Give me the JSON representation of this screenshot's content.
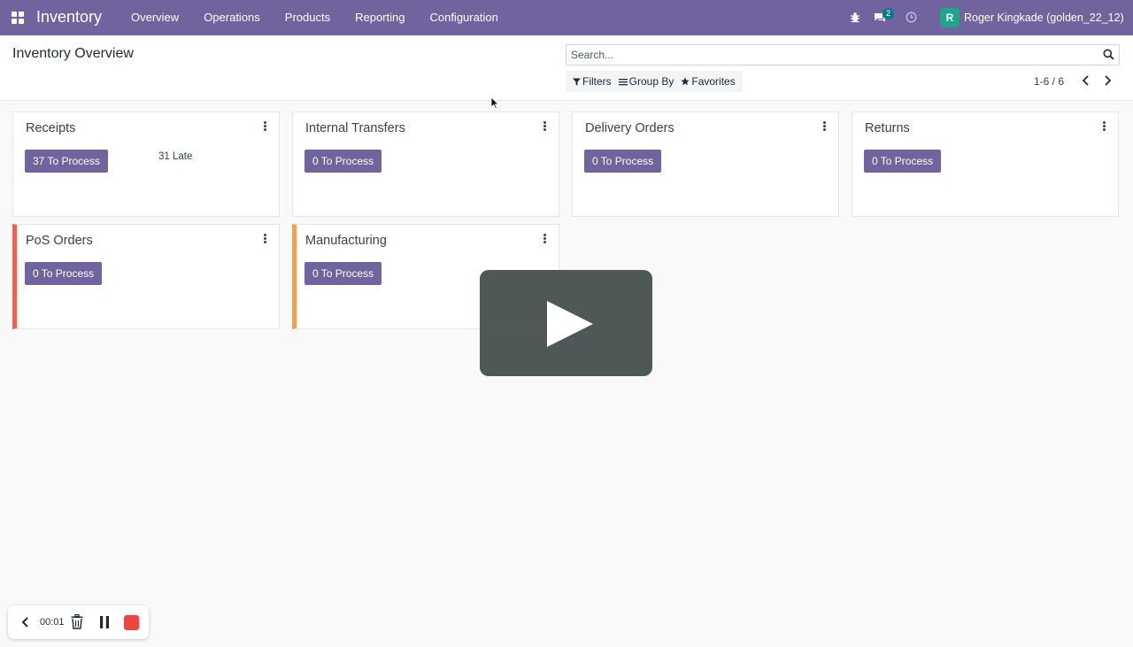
{
  "navbar": {
    "brand": "Inventory",
    "menu": [
      "Overview",
      "Operations",
      "Products",
      "Reporting",
      "Configuration"
    ],
    "chat_count": "2",
    "avatar_letter": "R",
    "user_name": "Roger Kingkade (golden_22_12)",
    "icons": [
      "apps-icon",
      "bug-icon",
      "chat-icon",
      "clock-icon"
    ]
  },
  "control_panel": {
    "title": "Inventory Overview",
    "search_placeholder": "Search...",
    "filters_label": "Filters",
    "group_by_label": "Group By",
    "favorites_label": "Favorites",
    "pager": "1-6 / 6"
  },
  "cards": [
    {
      "title": "Receipts",
      "button": "37 To Process",
      "late": "31 Late"
    },
    {
      "title": "Internal Transfers",
      "button": "0 To Process"
    },
    {
      "title": "Delivery Orders",
      "button": "0 To Process"
    },
    {
      "title": "Returns",
      "button": "0 To Process"
    },
    {
      "title": "PoS Orders",
      "button": "0 To Process",
      "accent": "#e86357"
    },
    {
      "title": "Manufacturing",
      "button": "0 To Process",
      "accent": "#eaa35b"
    }
  ],
  "recorder": {
    "time": "00:01"
  },
  "colors": {
    "brand": "#71639e",
    "badge": "#017e84",
    "avatar": "#1fa58b",
    "stop": "#ef4444"
  }
}
